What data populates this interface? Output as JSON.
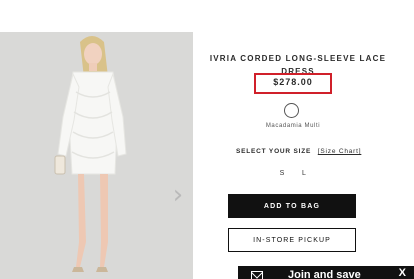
{
  "product": {
    "title": "IVRIA CORDED LONG-SLEEVE LACE DRESS",
    "price": "$278.00",
    "color_name": "Macadamia Multi",
    "size_label": "SELECT YOUR SIZE",
    "size_chart_link": "[Size Chart]",
    "sizes": [
      "S",
      "L"
    ],
    "add_to_bag_label": "ADD TO BAG",
    "pickup_label": "IN-STORE PICKUP"
  },
  "banner": {
    "join_text": "Join and save",
    "close_label": "X"
  },
  "colors": {
    "price_highlight": "#d0202a",
    "primary_button": "#111111"
  },
  "icons": {
    "gallery_next": "chevron-right-icon",
    "mail": "mail-icon"
  }
}
